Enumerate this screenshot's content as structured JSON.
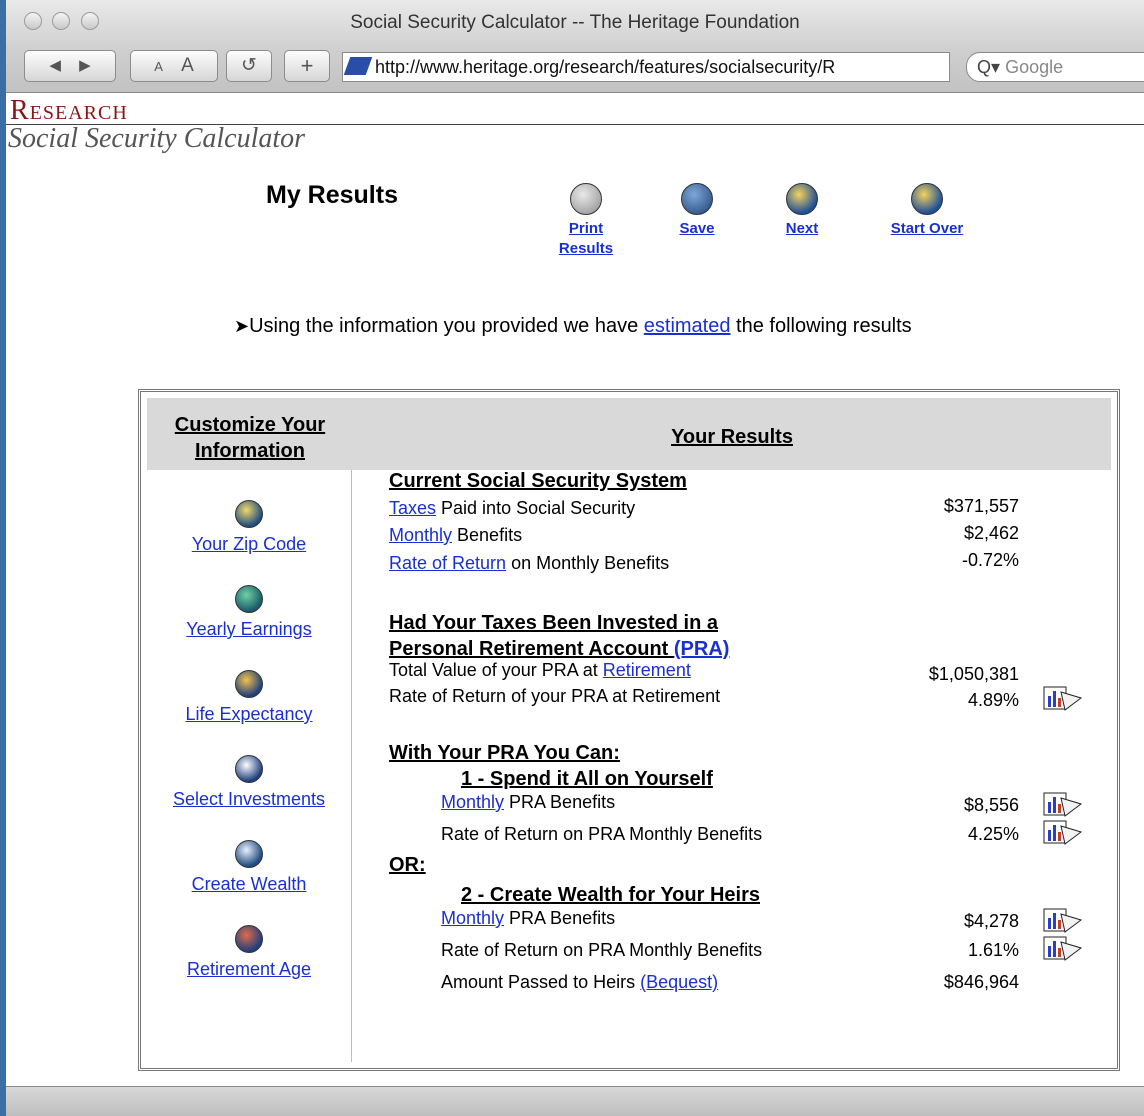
{
  "window": {
    "title": "Social Security Calculator -- The Heritage Foundation",
    "url": "http://www.heritage.org/research/features/socialsecurity/R",
    "search_placeholder": "Google",
    "toolbar": {
      "back": "◀",
      "forward": "▶",
      "text_smaller": "A",
      "text_bigger": "A",
      "reload": "↺",
      "add": "+"
    }
  },
  "brand": {
    "research": "Research",
    "subtitle": "Social Security Calculator"
  },
  "page": {
    "title": "My Results",
    "actions": {
      "print_line1": "Print",
      "print_line2": "Results",
      "save": "Save",
      "next": "Next",
      "start_over": "Start Over"
    },
    "intro": {
      "before": "Using the information you provided we have ",
      "link": "estimated",
      "after": " the following results"
    }
  },
  "table": {
    "left_header_line1": "Customize Your",
    "left_header_line2": "Information",
    "right_header": "Your Results",
    "nav": {
      "zip": "Your Zip Code",
      "earnings": "Yearly Earnings",
      "life": "Life Expectancy",
      "investments": "Select Investments",
      "wealth": "Create Wealth",
      "retirement": "Retirement Age"
    },
    "current": {
      "heading": "Current Social Security System",
      "taxes_link": "Taxes",
      "taxes_rest": " Paid into Social Security",
      "taxes_val": "$371,557",
      "monthly_link": "Monthly",
      "monthly_rest": " Benefits",
      "monthly_val": "$2,462",
      "ror_link": "Rate of Return",
      "ror_rest": " on Monthly Benefits",
      "ror_val": "-0.72%"
    },
    "pra": {
      "heading_line1": "Had Your Taxes Been Invested in a",
      "heading_line2": "Personal Retirement Account ",
      "heading_link": "(PRA)",
      "total_text": "Total Value of your PRA at ",
      "total_link": "Retirement",
      "total_val": "$1,050,381",
      "ror_text": "Rate of Return of your PRA at Retirement",
      "ror_val": "4.89%"
    },
    "options": {
      "heading": "With Your PRA You Can:",
      "opt1_heading": "1 - Spend it All on Yourself",
      "opt1_monthly_link": "Monthly",
      "opt1_monthly_rest": " PRA Benefits",
      "opt1_monthly_val": "$8,556",
      "opt1_ror_text": "Rate of Return on PRA Monthly Benefits",
      "opt1_ror_val": "4.25%",
      "or_label": "OR:",
      "opt2_heading": "2 - Create Wealth for Your Heirs",
      "opt2_monthly_link": "Monthly",
      "opt2_monthly_rest": " PRA Benefits",
      "opt2_monthly_val": "$4,278",
      "opt2_ror_text": "Rate of Return on PRA Monthly Benefits",
      "opt2_ror_val": "1.61%",
      "bequest_text": "Amount Passed to Heirs ",
      "bequest_link": "(Bequest)",
      "bequest_val": "$846,964"
    }
  },
  "colors": {
    "link": "#1a2fd0",
    "brand": "#8b1414",
    "header_bg": "#d9d9d9"
  }
}
